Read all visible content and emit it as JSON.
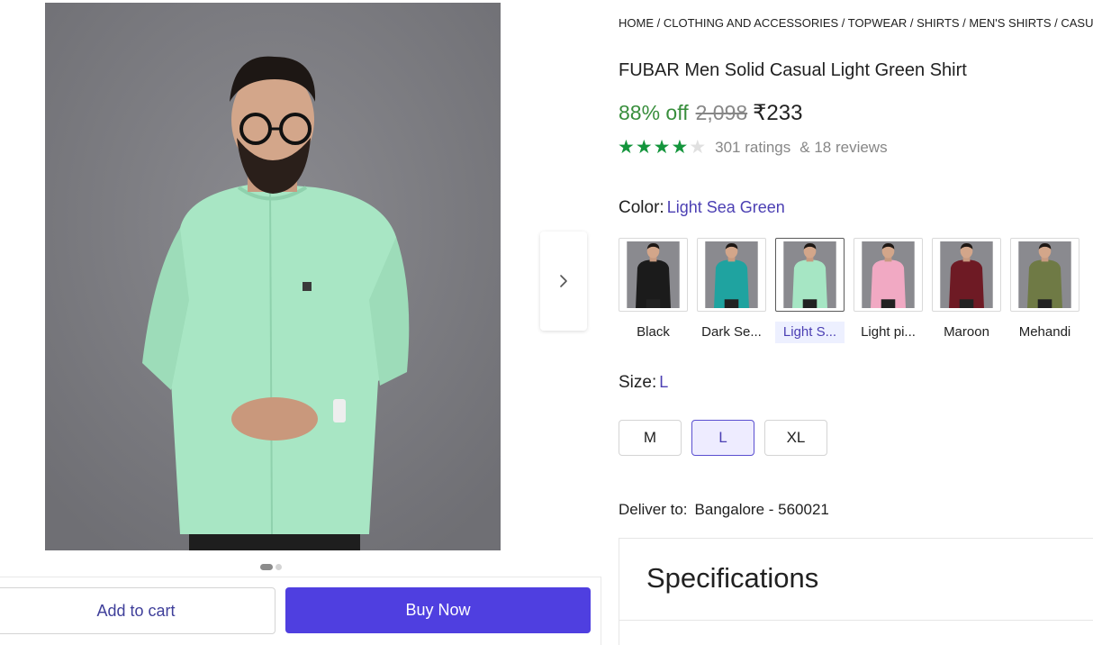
{
  "breadcrumb": [
    "HOME",
    "CLOTHING AND ACCESSORIES",
    "TOPWEAR",
    "SHIRTS",
    "MEN'S SHIRTS",
    "CASUAL"
  ],
  "breadcrumb_sep": " / ",
  "product": {
    "title": "FUBAR Men Solid Casual Light Green Shirt",
    "discount": "88% off",
    "mrp": "2,098",
    "price": "₹233",
    "rating_stars": 4,
    "rating_max": 5,
    "ratings_text": "301 ratings",
    "reviews_text": "& 18 reviews"
  },
  "color": {
    "label": "Color:",
    "selected": "Light Sea Green",
    "options": [
      {
        "name": "Black",
        "shirt": "#1b1b1b",
        "selected": false
      },
      {
        "name": "Dark Se...",
        "shirt": "#1fa3a0",
        "selected": false
      },
      {
        "name": "Light S...",
        "shirt": "#a6e6c4",
        "selected": true
      },
      {
        "name": "Light pi...",
        "shirt": "#f1a9c3",
        "selected": false
      },
      {
        "name": "Maroon",
        "shirt": "#6e1a24",
        "selected": false
      },
      {
        "name": "Mehandi",
        "shirt": "#6f7a45",
        "selected": false
      }
    ]
  },
  "size": {
    "label": "Size:",
    "selected": "L",
    "options": [
      "M",
      "L",
      "XL"
    ]
  },
  "delivery": {
    "label": "Deliver to:",
    "location": "Bangalore - 560021"
  },
  "specifications_title": "Specifications",
  "actions": {
    "add_to_cart": "Add to cart",
    "buy_now": "Buy Now"
  },
  "gallery": {
    "slide_count": 2,
    "active_slide": 1,
    "next_icon": "chevron-right-icon"
  },
  "colors": {
    "accent": "#4f3fe0",
    "discount_green": "#388e3c",
    "star_green": "#14953c",
    "link_purple": "#4b3fb3"
  }
}
